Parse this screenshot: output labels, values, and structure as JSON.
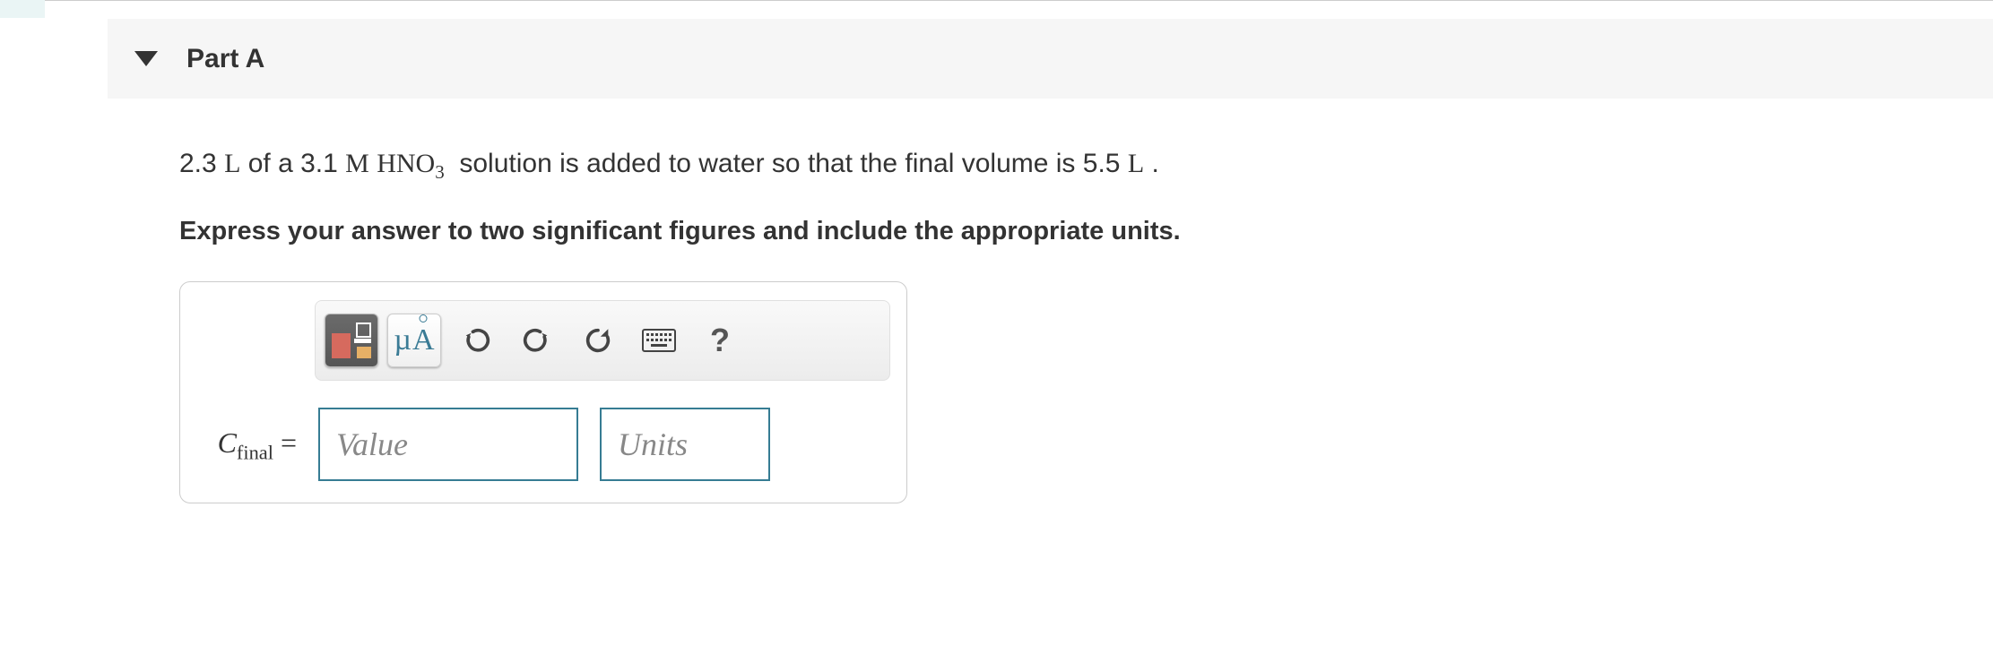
{
  "part": {
    "title": "Part A"
  },
  "problem": {
    "vol1": "2.3",
    "unit1": "L",
    "conc": "3.1",
    "concUnit": "M",
    "solute_base": "HNO",
    "solute_sub": "3",
    "mid": "solution is added to water so that the final volume is",
    "vol2": "5.5",
    "unit2": "L"
  },
  "instruction": "Express your answer to two significant figures and include the appropriate units.",
  "answer": {
    "label_var": "C",
    "label_sub": "final",
    "eq": "=",
    "value_placeholder": "Value",
    "units_placeholder": "Units"
  },
  "toolbar": {
    "mu": "µ",
    "A": "A",
    "help": "?"
  }
}
